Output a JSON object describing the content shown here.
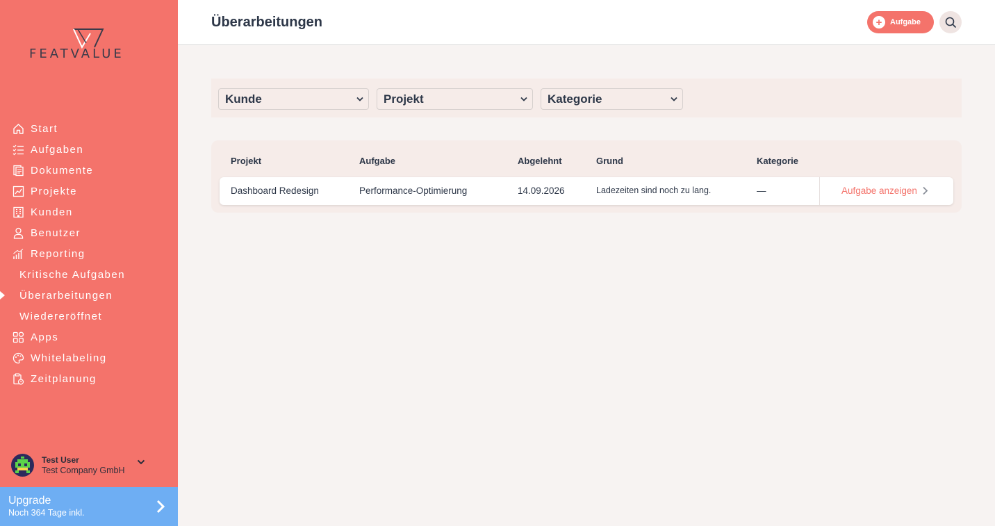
{
  "brand": {
    "name": "FEATVALUE"
  },
  "colors": {
    "primary": "#f4736b",
    "upgrade": "#6eaef3",
    "text": "#2d3748",
    "background": "#f7f3f2"
  },
  "sidebar": {
    "items": [
      {
        "label": "Start",
        "icon": "home-icon"
      },
      {
        "label": "Aufgaben",
        "icon": "tasks-icon"
      },
      {
        "label": "Dokumente",
        "icon": "documents-icon"
      },
      {
        "label": "Projekte",
        "icon": "projects-icon"
      },
      {
        "label": "Kunden",
        "icon": "building-icon"
      },
      {
        "label": "Benutzer",
        "icon": "user-icon"
      },
      {
        "label": "Reporting",
        "icon": "chart-icon"
      },
      {
        "label": "Kritische Aufgaben"
      },
      {
        "label": "Überarbeitungen",
        "active": true
      },
      {
        "label": "Wiedereröffnet"
      },
      {
        "label": "Apps",
        "icon": "apps-icon"
      },
      {
        "label": "Whitelabeling",
        "icon": "palette-icon"
      },
      {
        "label": "Zeitplanung",
        "icon": "schedule-icon"
      }
    ],
    "user": {
      "name": "Test User",
      "company": "Test Company GmbH"
    },
    "upgrade": {
      "title": "Upgrade",
      "subtitle": "Noch 364 Tage inkl."
    }
  },
  "header": {
    "title": "Überarbeitungen",
    "add_label": "Aufgabe"
  },
  "filters": [
    {
      "label": "Kunde"
    },
    {
      "label": "Projekt"
    },
    {
      "label": "Kategorie"
    }
  ],
  "table": {
    "columns": [
      "Projekt",
      "Aufgabe",
      "Abgelehnt",
      "Grund",
      "Kategorie"
    ],
    "rows": [
      {
        "projekt": "Dashboard Redesign",
        "aufgabe": "Performance-Optimierung",
        "abgelehnt": "14.09.2026",
        "grund": "Ladezeiten sind noch zu lang.",
        "kategorie": "—",
        "action": "Aufgabe anzeigen"
      }
    ]
  }
}
